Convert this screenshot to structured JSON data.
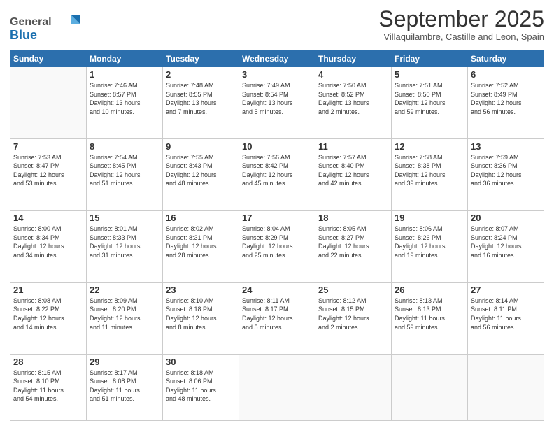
{
  "header": {
    "logo_general": "General",
    "logo_blue": "Blue",
    "month_title": "September 2025",
    "subtitle": "Villaquilambre, Castille and Leon, Spain"
  },
  "days_of_week": [
    "Sunday",
    "Monday",
    "Tuesday",
    "Wednesday",
    "Thursday",
    "Friday",
    "Saturday"
  ],
  "weeks": [
    [
      {
        "day": "",
        "info": ""
      },
      {
        "day": "1",
        "info": "Sunrise: 7:46 AM\nSunset: 8:57 PM\nDaylight: 13 hours\nand 10 minutes."
      },
      {
        "day": "2",
        "info": "Sunrise: 7:48 AM\nSunset: 8:55 PM\nDaylight: 13 hours\nand 7 minutes."
      },
      {
        "day": "3",
        "info": "Sunrise: 7:49 AM\nSunset: 8:54 PM\nDaylight: 13 hours\nand 5 minutes."
      },
      {
        "day": "4",
        "info": "Sunrise: 7:50 AM\nSunset: 8:52 PM\nDaylight: 13 hours\nand 2 minutes."
      },
      {
        "day": "5",
        "info": "Sunrise: 7:51 AM\nSunset: 8:50 PM\nDaylight: 12 hours\nand 59 minutes."
      },
      {
        "day": "6",
        "info": "Sunrise: 7:52 AM\nSunset: 8:49 PM\nDaylight: 12 hours\nand 56 minutes."
      }
    ],
    [
      {
        "day": "7",
        "info": "Sunrise: 7:53 AM\nSunset: 8:47 PM\nDaylight: 12 hours\nand 53 minutes."
      },
      {
        "day": "8",
        "info": "Sunrise: 7:54 AM\nSunset: 8:45 PM\nDaylight: 12 hours\nand 51 minutes."
      },
      {
        "day": "9",
        "info": "Sunrise: 7:55 AM\nSunset: 8:43 PM\nDaylight: 12 hours\nand 48 minutes."
      },
      {
        "day": "10",
        "info": "Sunrise: 7:56 AM\nSunset: 8:42 PM\nDaylight: 12 hours\nand 45 minutes."
      },
      {
        "day": "11",
        "info": "Sunrise: 7:57 AM\nSunset: 8:40 PM\nDaylight: 12 hours\nand 42 minutes."
      },
      {
        "day": "12",
        "info": "Sunrise: 7:58 AM\nSunset: 8:38 PM\nDaylight: 12 hours\nand 39 minutes."
      },
      {
        "day": "13",
        "info": "Sunrise: 7:59 AM\nSunset: 8:36 PM\nDaylight: 12 hours\nand 36 minutes."
      }
    ],
    [
      {
        "day": "14",
        "info": "Sunrise: 8:00 AM\nSunset: 8:34 PM\nDaylight: 12 hours\nand 34 minutes."
      },
      {
        "day": "15",
        "info": "Sunrise: 8:01 AM\nSunset: 8:33 PM\nDaylight: 12 hours\nand 31 minutes."
      },
      {
        "day": "16",
        "info": "Sunrise: 8:02 AM\nSunset: 8:31 PM\nDaylight: 12 hours\nand 28 minutes."
      },
      {
        "day": "17",
        "info": "Sunrise: 8:04 AM\nSunset: 8:29 PM\nDaylight: 12 hours\nand 25 minutes."
      },
      {
        "day": "18",
        "info": "Sunrise: 8:05 AM\nSunset: 8:27 PM\nDaylight: 12 hours\nand 22 minutes."
      },
      {
        "day": "19",
        "info": "Sunrise: 8:06 AM\nSunset: 8:26 PM\nDaylight: 12 hours\nand 19 minutes."
      },
      {
        "day": "20",
        "info": "Sunrise: 8:07 AM\nSunset: 8:24 PM\nDaylight: 12 hours\nand 16 minutes."
      }
    ],
    [
      {
        "day": "21",
        "info": "Sunrise: 8:08 AM\nSunset: 8:22 PM\nDaylight: 12 hours\nand 14 minutes."
      },
      {
        "day": "22",
        "info": "Sunrise: 8:09 AM\nSunset: 8:20 PM\nDaylight: 12 hours\nand 11 minutes."
      },
      {
        "day": "23",
        "info": "Sunrise: 8:10 AM\nSunset: 8:18 PM\nDaylight: 12 hours\nand 8 minutes."
      },
      {
        "day": "24",
        "info": "Sunrise: 8:11 AM\nSunset: 8:17 PM\nDaylight: 12 hours\nand 5 minutes."
      },
      {
        "day": "25",
        "info": "Sunrise: 8:12 AM\nSunset: 8:15 PM\nDaylight: 12 hours\nand 2 minutes."
      },
      {
        "day": "26",
        "info": "Sunrise: 8:13 AM\nSunset: 8:13 PM\nDaylight: 11 hours\nand 59 minutes."
      },
      {
        "day": "27",
        "info": "Sunrise: 8:14 AM\nSunset: 8:11 PM\nDaylight: 11 hours\nand 56 minutes."
      }
    ],
    [
      {
        "day": "28",
        "info": "Sunrise: 8:15 AM\nSunset: 8:10 PM\nDaylight: 11 hours\nand 54 minutes."
      },
      {
        "day": "29",
        "info": "Sunrise: 8:17 AM\nSunset: 8:08 PM\nDaylight: 11 hours\nand 51 minutes."
      },
      {
        "day": "30",
        "info": "Sunrise: 8:18 AM\nSunset: 8:06 PM\nDaylight: 11 hours\nand 48 minutes."
      },
      {
        "day": "",
        "info": ""
      },
      {
        "day": "",
        "info": ""
      },
      {
        "day": "",
        "info": ""
      },
      {
        "day": "",
        "info": ""
      }
    ]
  ]
}
